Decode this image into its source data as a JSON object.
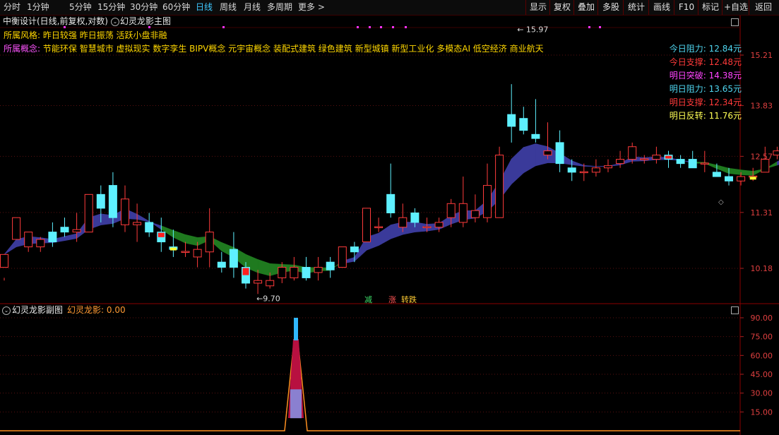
{
  "toolbar": {
    "periods": [
      "分时",
      "1分钟",
      "5分钟",
      "15分钟",
      "30分钟",
      "60分钟",
      "日线",
      "周线",
      "月线",
      "多周期",
      "更多 >"
    ],
    "active_period": "日线",
    "right_buttons": [
      "显示",
      "复权",
      "叠加",
      "多股",
      "统计",
      "画线",
      "F10",
      "标记",
      "+自选",
      "返回"
    ]
  },
  "main_header": {
    "title": "中衡设计(日线,前复权,对数)",
    "indicator": "幻灵龙影主图"
  },
  "info": {
    "style_label": "所属风格:",
    "style_value": "昨日较强 昨日振荡 活跃小盘非融",
    "concept_label": "所属概念:",
    "concept_value": "节能环保 智慧城市 虚拟现实 数字孪生 BIPV概念 元宇宙概念 装配式建筑 绿色建筑 新型城镇 新型工业化 多模态AI 低空经济 商业航天"
  },
  "levels": [
    {
      "label": "今日阻力:",
      "value": "12.84",
      "unit": "元",
      "color": "#4fd6f0"
    },
    {
      "label": "今日支撑:",
      "value": "12.48",
      "unit": "元",
      "color": "#ff3a3a"
    },
    {
      "label": "明日突破:",
      "value": "14.38",
      "unit": "元",
      "color": "#ff44ff"
    },
    {
      "label": "明日阻力:",
      "value": "13.65",
      "unit": "元",
      "color": "#4fd6f0"
    },
    {
      "label": "明日支撑:",
      "value": "12.34",
      "unit": "元",
      "color": "#ff3a3a"
    },
    {
      "label": "明日反转:",
      "value": "11.76",
      "unit": "元",
      "color": "#ffff55"
    }
  ],
  "price_axis": [
    "15.21",
    "13.83",
    "12.57",
    "11.31",
    "10.18"
  ],
  "annotations": {
    "high": "15.97",
    "low": "9.70"
  },
  "tags": [
    {
      "text": "减",
      "color": "#3ee06a"
    },
    {
      "text": "涨",
      "color": "#ff5555"
    },
    {
      "text": "转跌",
      "color": "#ffcc33"
    }
  ],
  "sub_header": {
    "title": "幻灵龙影副图",
    "indicator_label": "幻灵龙影:",
    "indicator_value": "0.00"
  },
  "chart_data": {
    "type": "candlestick",
    "price_axis_ticks": [
      15.21,
      13.83,
      12.57,
      11.31,
      10.18
    ],
    "high": 15.97,
    "low": 9.7,
    "candles": [
      [
        10.2,
        10.45,
        10.0,
        9.95
      ],
      [
        10.75,
        11.2,
        11.2,
        11.2
      ],
      [
        10.6,
        10.9,
        10.9,
        10.5
      ],
      [
        10.6,
        10.75,
        10.8,
        10.5
      ],
      [
        10.9,
        10.7,
        11.1,
        10.6
      ],
      [
        11.0,
        10.9,
        11.2,
        10.8
      ],
      [
        10.9,
        10.95,
        11.3,
        10.7
      ],
      [
        10.9,
        11.7,
        11.7,
        10.9
      ],
      [
        11.7,
        11.4,
        11.9,
        11.1
      ],
      [
        11.9,
        11.2,
        12.2,
        11.0
      ],
      [
        11.05,
        11.6,
        11.9,
        10.9
      ],
      [
        11.05,
        11.1,
        11.5,
        10.7
      ],
      [
        11.1,
        10.9,
        11.3,
        10.8
      ],
      [
        10.9,
        10.7,
        11.2,
        10.5
      ],
      [
        10.6,
        10.55,
        10.95,
        10.4
      ],
      [
        10.5,
        10.5,
        10.7,
        10.4
      ],
      [
        10.4,
        10.55,
        10.7,
        10.2
      ],
      [
        10.5,
        10.9,
        11.4,
        10.2
      ],
      [
        10.3,
        10.2,
        10.5,
        10.1
      ],
      [
        10.55,
        10.2,
        10.9,
        10.0
      ],
      [
        10.2,
        9.9,
        10.3,
        9.8
      ],
      [
        9.9,
        9.95,
        10.15,
        9.7
      ],
      [
        9.85,
        9.95,
        10.1,
        9.8
      ],
      [
        10.0,
        10.2,
        10.3,
        9.9
      ],
      [
        10.0,
        10.2,
        10.4,
        9.95
      ],
      [
        10.2,
        10.0,
        10.4,
        9.95
      ],
      [
        10.1,
        10.2,
        10.4,
        9.95
      ],
      [
        10.3,
        10.15,
        10.4,
        10.0
      ],
      [
        10.2,
        10.6,
        10.6,
        10.2
      ],
      [
        10.6,
        10.5,
        10.7,
        10.3
      ],
      [
        10.7,
        11.4,
        11.4,
        10.7
      ],
      [
        11.0,
        11.0,
        11.2,
        10.9
      ],
      [
        11.7,
        11.3,
        12.4,
        11.2
      ],
      [
        11.0,
        11.2,
        11.5,
        10.9
      ],
      [
        11.3,
        11.1,
        11.4,
        11.0
      ],
      [
        11.0,
        11.0,
        11.2,
        10.9
      ],
      [
        11.0,
        11.1,
        11.2,
        10.9
      ],
      [
        11.2,
        11.5,
        11.6,
        11.0
      ],
      [
        11.1,
        11.5,
        12.1,
        11.0
      ],
      [
        11.2,
        11.35,
        11.7,
        11.1
      ],
      [
        11.2,
        11.9,
        12.4,
        11.1
      ],
      [
        11.2,
        12.6,
        12.8,
        11.2
      ],
      [
        13.6,
        13.3,
        14.4,
        12.9
      ],
      [
        13.5,
        13.2,
        13.8,
        13.1
      ],
      [
        13.1,
        13.0,
        14.0,
        12.9
      ],
      [
        12.6,
        12.7,
        13.4,
        12.5
      ],
      [
        12.9,
        12.4,
        13.2,
        12.2
      ],
      [
        12.3,
        12.2,
        12.5,
        12.0
      ],
      [
        12.2,
        12.2,
        12.4,
        12.0
      ],
      [
        12.2,
        12.3,
        12.5,
        12.1
      ],
      [
        12.3,
        12.35,
        12.5,
        12.2
      ],
      [
        12.4,
        12.5,
        12.7,
        12.3
      ],
      [
        12.5,
        12.8,
        12.9,
        12.4
      ],
      [
        12.5,
        12.5,
        12.6,
        12.4
      ],
      [
        12.5,
        12.6,
        12.8,
        12.4
      ],
      [
        12.6,
        12.5,
        12.7,
        12.3
      ],
      [
        12.5,
        12.4,
        12.6,
        12.3
      ],
      [
        12.5,
        12.3,
        12.7,
        12.3
      ],
      [
        12.4,
        12.4,
        12.7,
        12.2
      ],
      [
        12.2,
        12.1,
        12.4,
        12.1
      ],
      [
        12.1,
        12.0,
        12.3,
        11.9
      ],
      [
        12.0,
        12.1,
        12.2,
        11.9
      ],
      [
        12.1,
        12.1,
        12.3,
        12.0
      ],
      [
        12.2,
        12.5,
        12.8,
        12.2
      ],
      [
        12.6,
        12.7,
        12.8,
        12.5
      ],
      [
        12.5,
        12.8,
        12.8,
        12.5
      ],
      [
        12.7,
        12.7,
        12.9,
        12.6
      ],
      [
        12.9,
        12.8,
        13.0,
        12.7
      ],
      [
        12.7,
        12.6,
        12.8,
        12.5
      ],
      [
        12.6,
        12.8,
        13.0,
        12.6
      ],
      [
        12.7,
        12.8,
        13.0,
        12.6
      ],
      [
        12.8,
        12.8,
        13.0,
        12.7
      ],
      [
        12.8,
        12.7,
        13.0,
        12.6
      ],
      [
        12.9,
        13.4,
        13.8,
        12.6
      ]
    ],
    "sub_series": {
      "name": "幻灵龙影",
      "ylim": [
        0,
        100
      ],
      "ticks": [
        15,
        30,
        45,
        60,
        75,
        90
      ],
      "peak_value": 90,
      "current_value": 0.0
    }
  }
}
